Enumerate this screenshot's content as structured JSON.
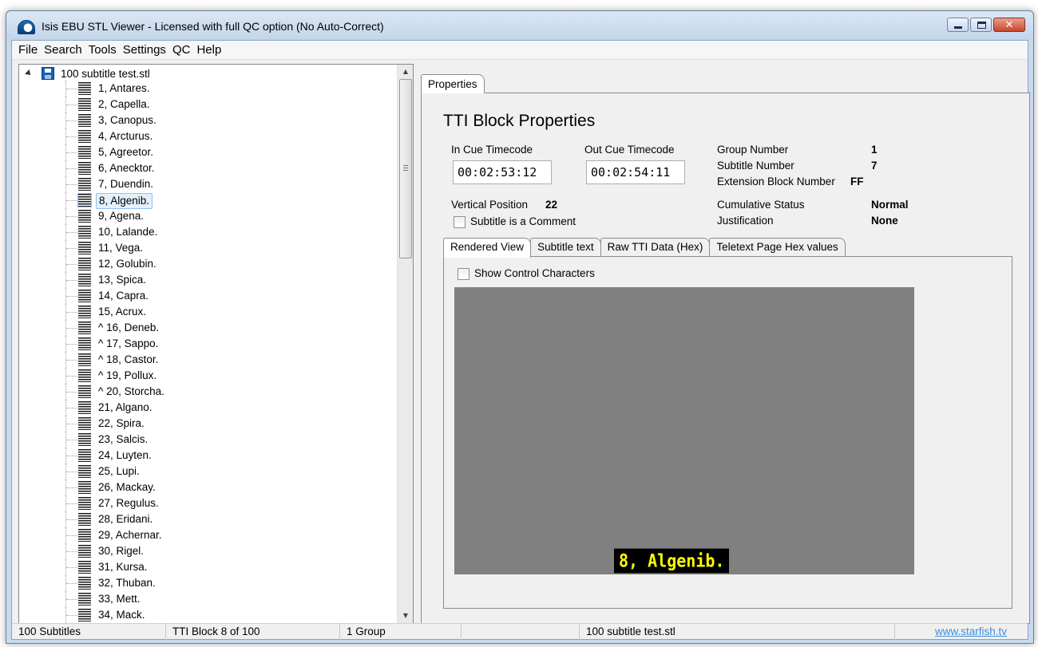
{
  "window": {
    "title": "Isis EBU STL Viewer - Licensed with full QC option (No Auto-Correct)",
    "caption_buttons": [
      "minimize",
      "maximize",
      "close"
    ]
  },
  "menu": [
    "File",
    "Search",
    "Tools",
    "Settings",
    "QC",
    "Help"
  ],
  "tree": {
    "root": "100 subtitle test.stl",
    "selected_index": 7,
    "items": [
      "1, Antares.",
      "2, Capella.",
      "3, Canopus.",
      "4, Arcturus.",
      "5, Agreetor.",
      "6, Anecktor.",
      "7, Duendin.",
      "8, Algenib.",
      "9, Agena.",
      "10, Lalande.",
      "11, Vega.",
      "12, Golubin.",
      "13, Spica.",
      "14, Capra.",
      "15, Acrux.",
      "^ 16, Deneb.",
      "^ 17, Sappo.",
      "^ 18, Castor.",
      "^ 19, Pollux.",
      "^ 20, Storcha.",
      "21, Algano.",
      "22, Spira.",
      "23, Salcis.",
      "24, Luyten.",
      "25, Lupi.",
      "26, Mackay.",
      "27, Regulus.",
      "28, Eridani.",
      "29, Achernar.",
      "30, Rigel.",
      "31, Kursa.",
      "32, Thuban.",
      "33, Mett.",
      "34, Mack."
    ]
  },
  "properties": {
    "tab_label": "Properties",
    "heading": "TTI Block Properties",
    "in_cue_label": "In Cue Timecode",
    "in_cue_value": "00:02:53:12",
    "out_cue_label": "Out Cue Timecode",
    "out_cue_value": "00:02:54:11",
    "group_number_label": "Group Number",
    "group_number_value": "1",
    "subtitle_number_label": "Subtitle Number",
    "subtitle_number_value": "7",
    "ext_block_label": "Extension Block Number",
    "ext_block_value": "FF",
    "vertical_position_label": "Vertical Position",
    "vertical_position_value": "22",
    "comment_checkbox_label": "Subtitle is a Comment",
    "comment_checked": false,
    "cumulative_status_label": "Cumulative Status",
    "cumulative_status_value": "Normal",
    "justification_label": "Justification",
    "justification_value": "None"
  },
  "inner_tabs": {
    "active": "Rendered View",
    "labels": [
      "Rendered View",
      "Subtitle text",
      "Raw TTI Data (Hex)",
      "Teletext Page Hex values"
    ]
  },
  "rendered_view": {
    "show_control_chars_label": "Show Control Characters",
    "show_control_chars_checked": false,
    "subtitle_text": "8, Algenib.",
    "background_color": "#808080",
    "text_color": "#ffff00",
    "strip_color": "#000000"
  },
  "status": {
    "subtitles": "100 Subtitles",
    "block": "TTI Block 8 of 100",
    "groups": "1 Group",
    "empty": "",
    "file": "100 subtitle test.stl",
    "link": "www.starfish.tv"
  }
}
